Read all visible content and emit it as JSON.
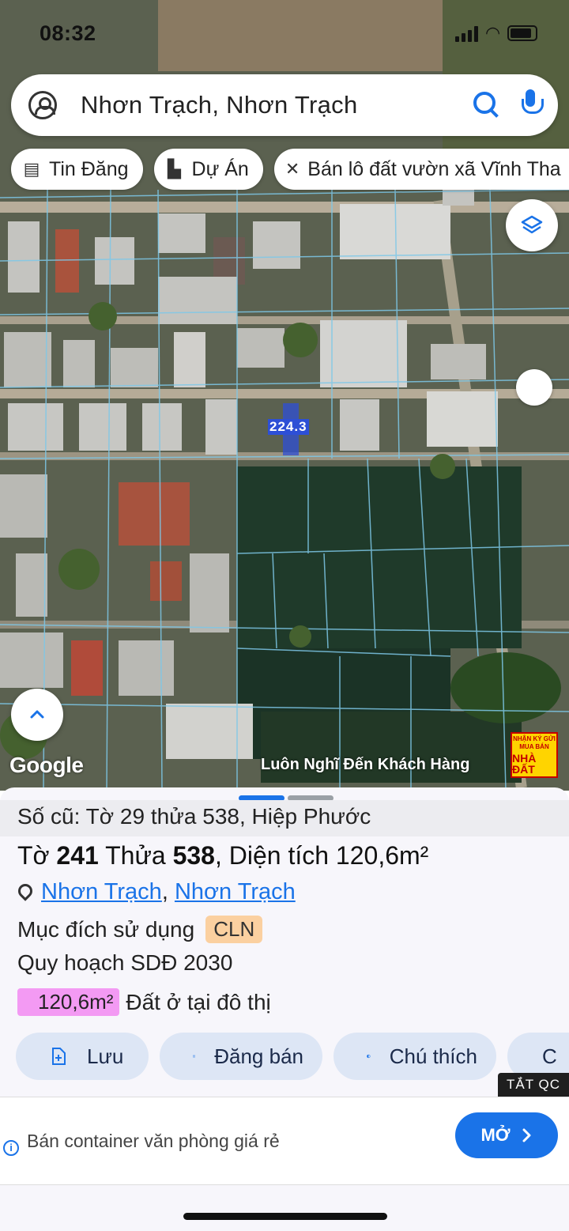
{
  "status_bar": {
    "time": "08:32"
  },
  "search": {
    "query": "Nhơn Trạch, Nhơn Trạch"
  },
  "filter_chips": [
    {
      "label": "Tin Đăng",
      "icon": "listing-icon"
    },
    {
      "label": "Dự Án",
      "icon": "building-icon"
    },
    {
      "label": "Bán lô đất vườn xã Vĩnh Tha",
      "icon": "tools-icon"
    }
  ],
  "map": {
    "parcel_label": "224.3",
    "attribution": "Google",
    "watermark_text": "Luôn Nghĩ Đến Khách Hàng",
    "watermark_logo": {
      "line1": "NHẬN KÝ GỬI",
      "line2": "MUA BÁN",
      "line3": "NHÀ ĐẤT"
    }
  },
  "sheet": {
    "old_info": "Số cũ: Tờ 29 thửa 538, Hiệp Phước",
    "title": {
      "sheet_prefix": "Tờ",
      "sheet_no": "241",
      "plot_prefix": "Thửa",
      "plot_no": "538",
      "area_prefix": ", Diện tích",
      "area": "120,6m²"
    },
    "location": {
      "district": "Nhơn Trạch",
      "separator": ",",
      "commune": "Nhơn Trạch"
    },
    "purpose": {
      "label": "Mục đích sử dụng",
      "code": "CLN"
    },
    "plan": "Quy hoạch SDĐ 2030",
    "zone": {
      "area": "120,6m²",
      "description": "Đất ở tại đô thị"
    },
    "actions": [
      {
        "label": "Lưu",
        "icon": "save-icon"
      },
      {
        "label": "Đăng bán",
        "icon": "calendar-icon"
      },
      {
        "label": "Chú thích",
        "icon": "contrast-icon"
      },
      {
        "label": "C",
        "icon": "camera-icon"
      }
    ]
  },
  "ad": {
    "close_label": "TẮT QC",
    "text": "Bán container văn phòng giá rẻ",
    "open_label": "MỞ"
  },
  "colors": {
    "accent": "#1a73e8",
    "parcel_lines": "#7ec8e8",
    "highlight_parcel": "#2d4fd6",
    "zone_badge": "#f39af3",
    "purpose_badge": "#fbd0a0",
    "handle_active": "#1a73e8",
    "handle_inactive": "#9aa0a6"
  }
}
